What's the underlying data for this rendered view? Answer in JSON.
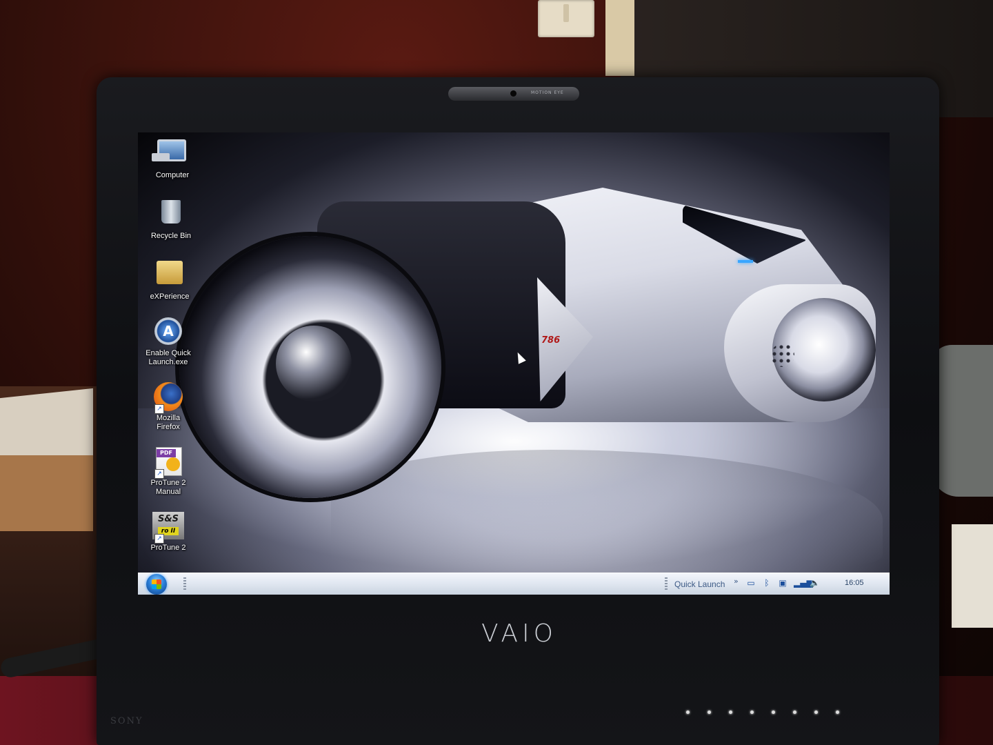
{
  "desktop": {
    "icons": [
      {
        "label": "Computer",
        "icon": "computer-icon"
      },
      {
        "label": "Recycle Bin",
        "icon": "recycle-bin-icon"
      },
      {
        "label": "eXPerience",
        "icon": "folder-icon"
      },
      {
        "label": "Enable Quick\nLaunch.exe",
        "icon": "aim-icon"
      },
      {
        "label": "Mozilla\nFirefox",
        "icon": "firefox-icon"
      },
      {
        "label": "ProTune 2\nManual",
        "icon": "pdf-icon"
      },
      {
        "label": "ProTune 2",
        "icon": "ss-protune-icon"
      }
    ],
    "ss_logo_text": "S&S",
    "ss_logo_sub": "ro II",
    "wallpaper_number": "786"
  },
  "taskbar": {
    "quick_launch_label": "Quick Launch",
    "chevron": "»",
    "tray_icons": [
      "desktop-icon",
      "bluetooth-icon",
      "network-icon",
      "signal-icon",
      "volume-icon"
    ],
    "clock": "16:05"
  },
  "hardware": {
    "webcam_label": "MOTION EYE",
    "brand_logo": "VAIO",
    "maker_logo": "SONY"
  },
  "colors": {
    "taskbar": "#dfe6f0",
    "start_orb": "#2a7fd8",
    "number": "#b01818"
  }
}
